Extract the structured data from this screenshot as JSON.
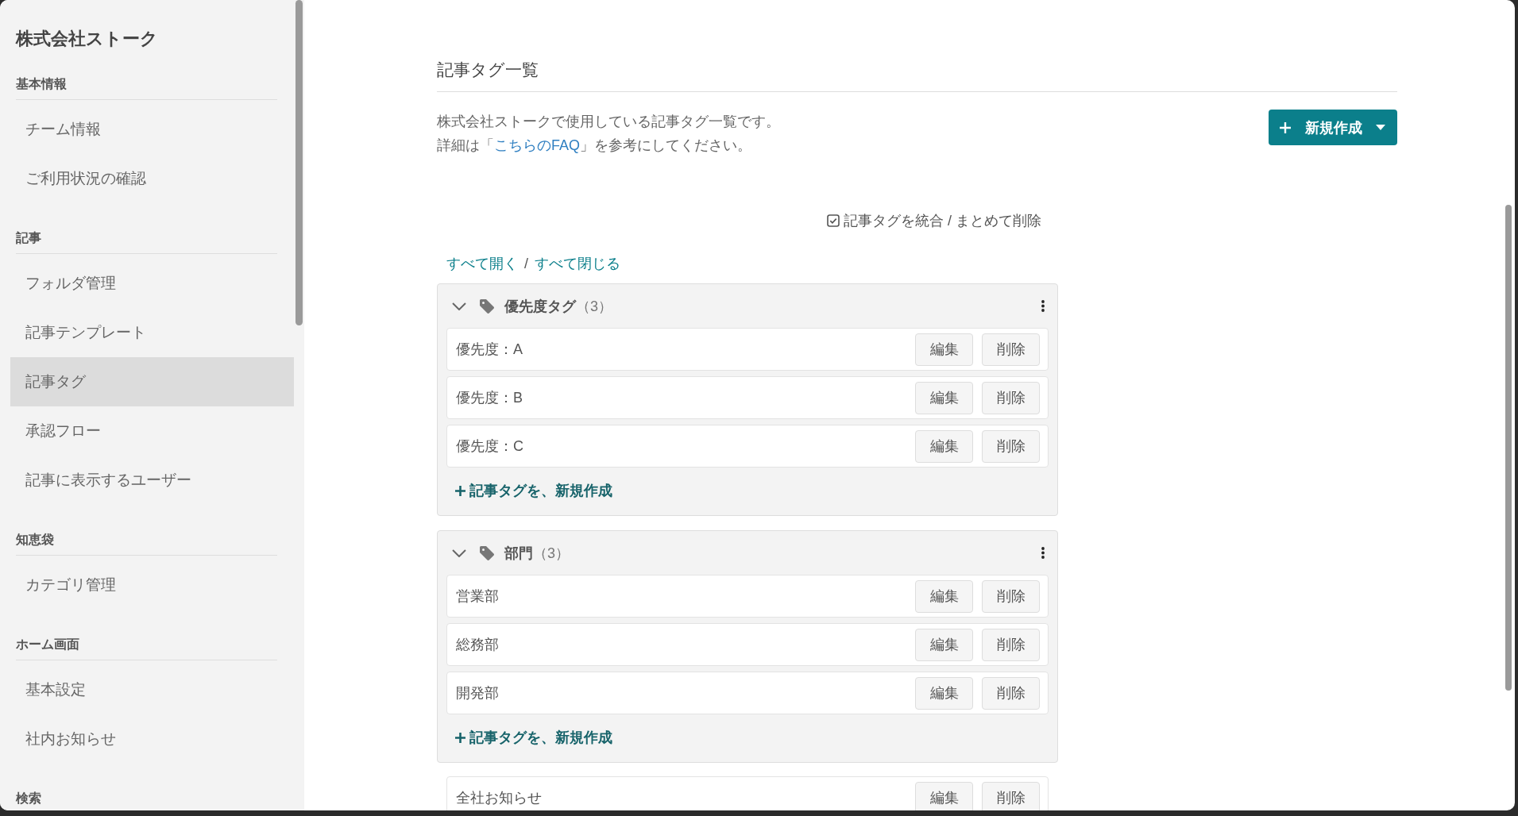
{
  "sidebar": {
    "title": "株式会社ストーク",
    "sections": [
      {
        "heading": "基本情報",
        "items": [
          {
            "label": "チーム情報",
            "selected": false
          },
          {
            "label": "ご利用状況の確認",
            "selected": false
          }
        ]
      },
      {
        "heading": "記事",
        "items": [
          {
            "label": "フォルダ管理",
            "selected": false
          },
          {
            "label": "記事テンプレート",
            "selected": false
          },
          {
            "label": "記事タグ",
            "selected": true
          },
          {
            "label": "承認フロー",
            "selected": false
          },
          {
            "label": "記事に表示するユーザー",
            "selected": false
          }
        ]
      },
      {
        "heading": "知恵袋",
        "items": [
          {
            "label": "カテゴリ管理",
            "selected": false
          }
        ]
      },
      {
        "heading": "ホーム画面",
        "items": [
          {
            "label": "基本設定",
            "selected": false
          },
          {
            "label": "社内お知らせ",
            "selected": false
          }
        ]
      },
      {
        "heading": "検索"
      }
    ]
  },
  "main": {
    "title": "記事タグ一覧",
    "description": [
      [
        {
          "text": "株式会社ストークで使用している記事タグ一覧です。"
        }
      ],
      [
        {
          "text": "詳細は「"
        },
        {
          "text": "こちらのFAQ",
          "kind": "link"
        },
        {
          "text": "」を参考にしてください。"
        }
      ]
    ],
    "new_button": "新規作成",
    "merge_button": "記事タグを統合 / まとめて削除",
    "expand_all": "すべて開く",
    "separator": "/",
    "collapse_all": "すべて閉じる",
    "tag_groups": [
      {
        "name": "優先度タグ",
        "count": "（3）",
        "expanded": true,
        "tags": [
          {
            "name": "優先度：A",
            "edit": "編集",
            "delete": "削除"
          },
          {
            "name": "優先度：B",
            "edit": "編集",
            "delete": "削除"
          },
          {
            "name": "優先度：C",
            "edit": "編集",
            "delete": "削除"
          }
        ],
        "add_link": "記事タグを、新規作成"
      },
      {
        "name": "部門",
        "count": "（3）",
        "expanded": true,
        "tags": [
          {
            "name": "営業部",
            "edit": "編集",
            "delete": "削除"
          },
          {
            "name": "総務部",
            "edit": "編集",
            "delete": "削除"
          },
          {
            "name": "開発部",
            "edit": "編集",
            "delete": "削除"
          }
        ],
        "add_link": "記事タグを、新規作成"
      }
    ],
    "ungrouped_tags": [
      {
        "name": "全社お知らせ",
        "edit": "編集",
        "delete": "削除"
      }
    ]
  }
}
